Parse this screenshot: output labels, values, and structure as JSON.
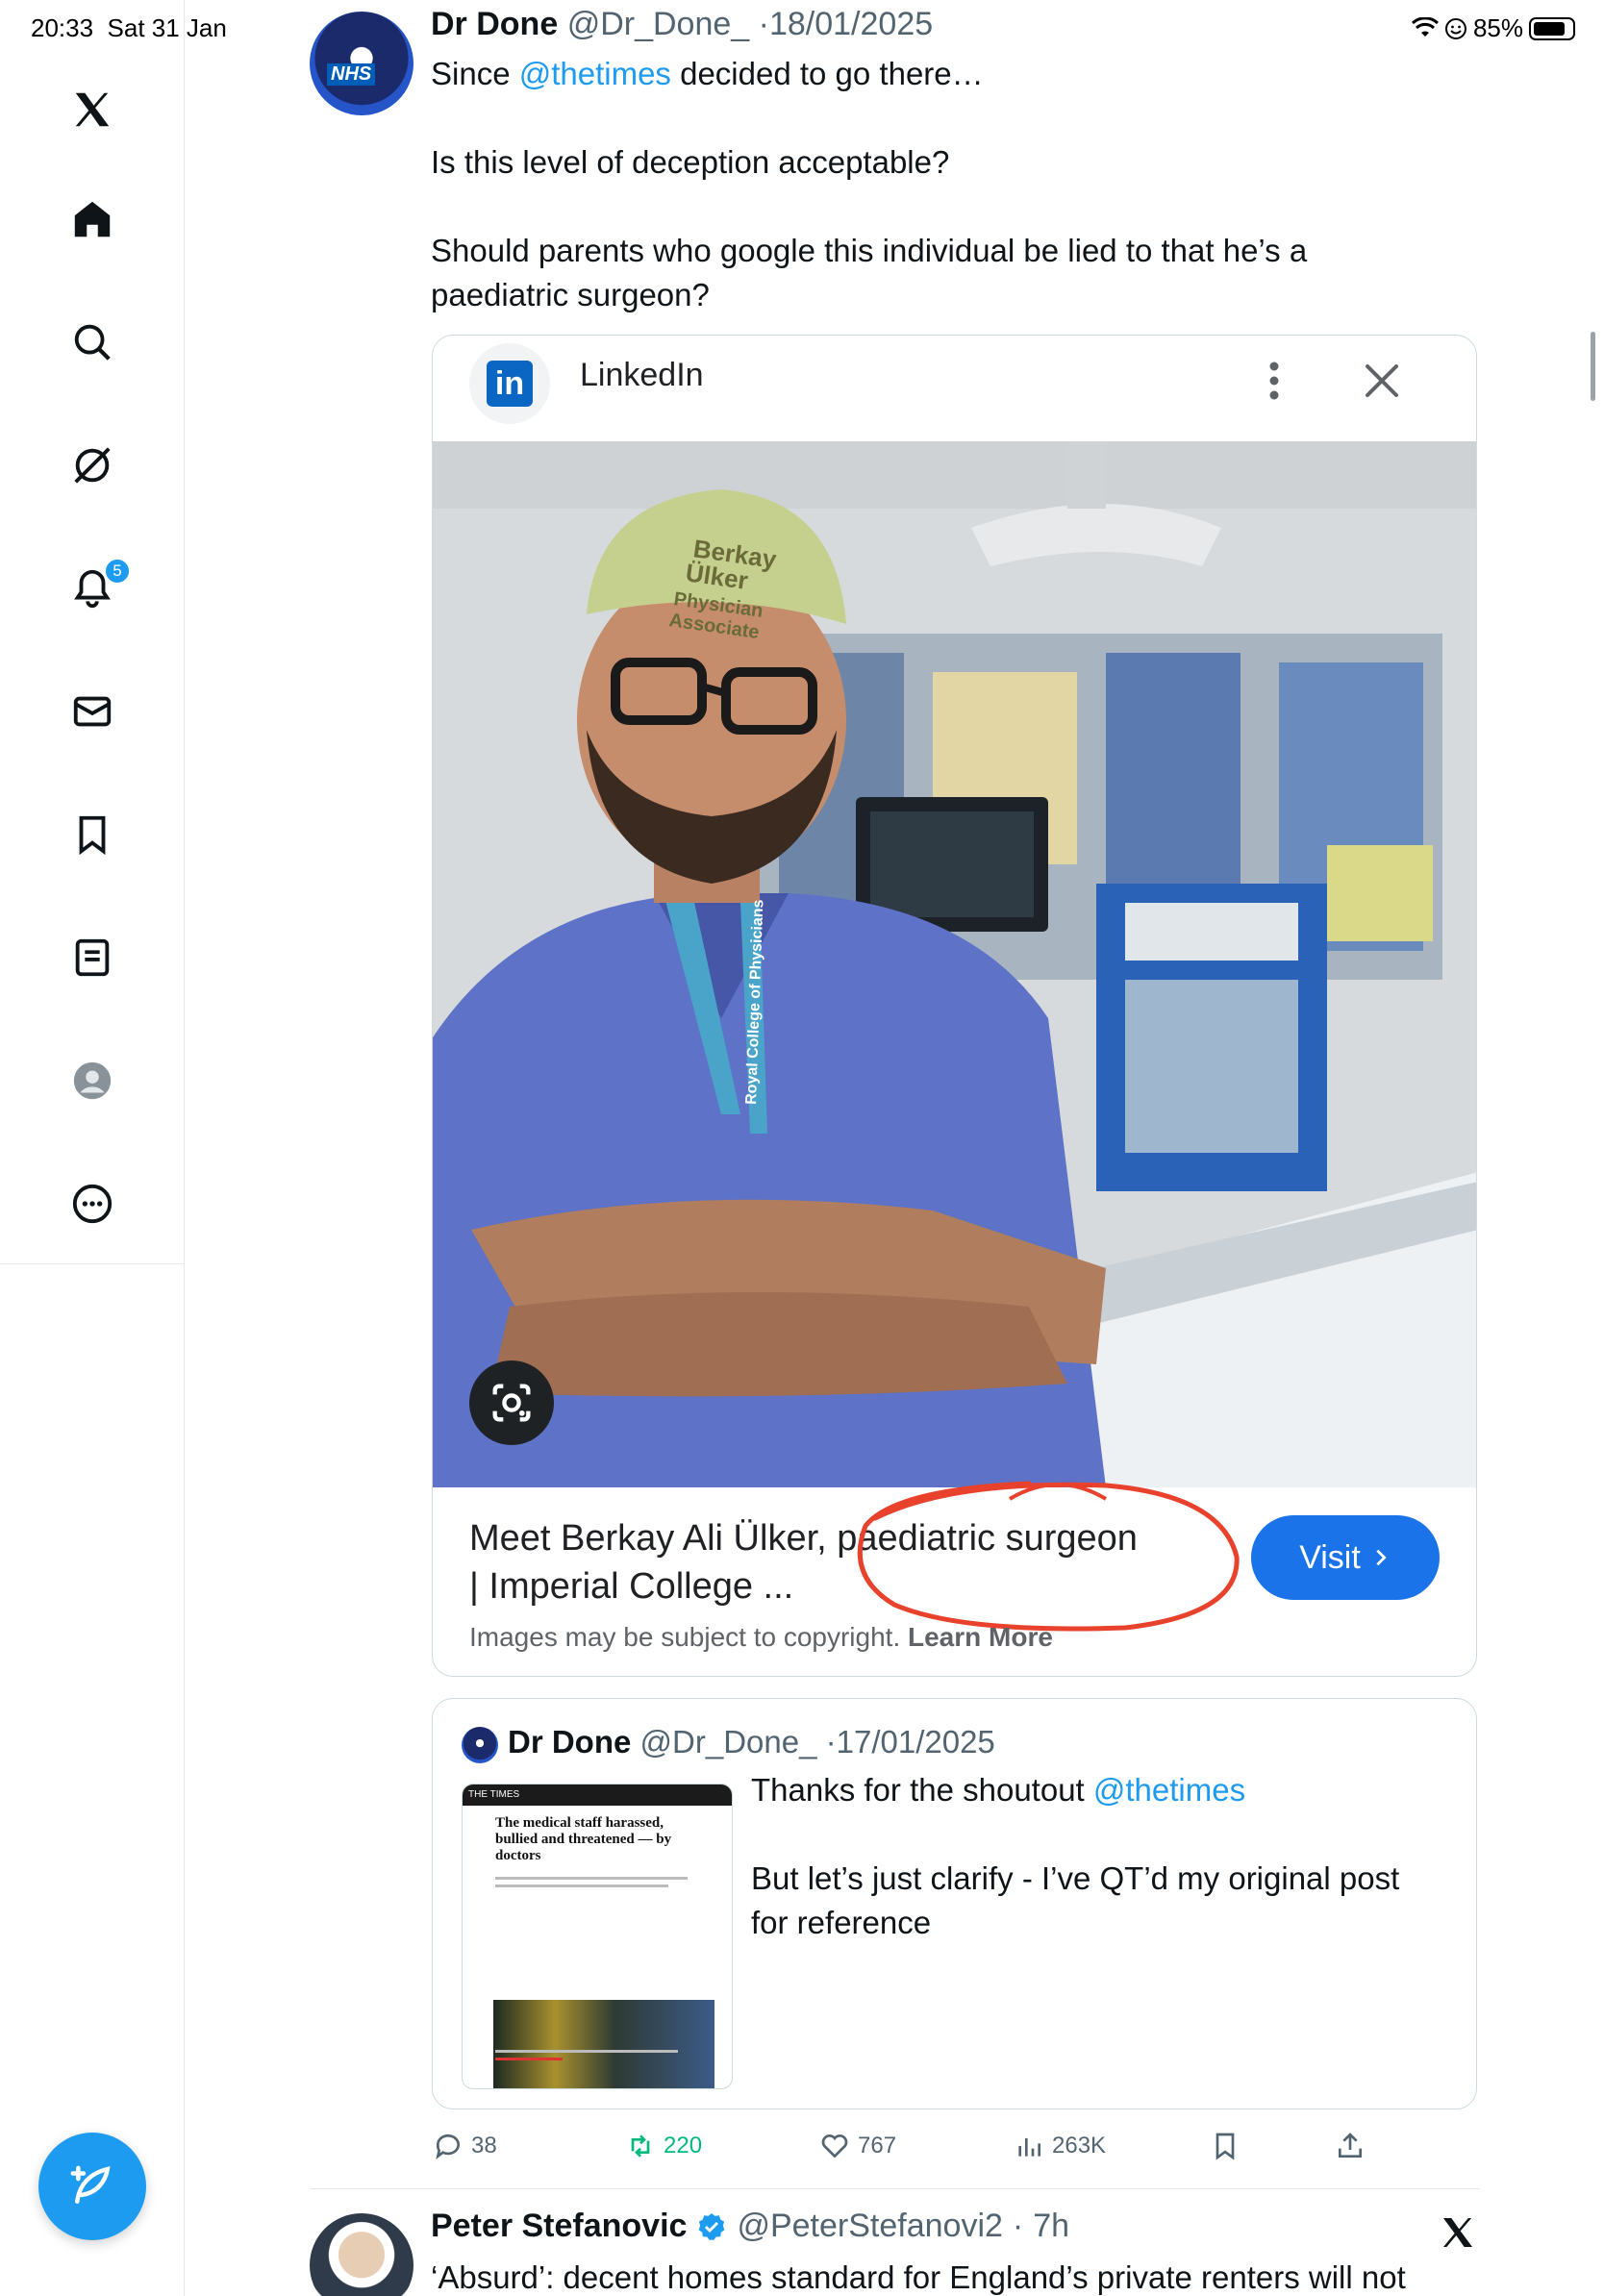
{
  "status_bar": {
    "time": "20:33",
    "date": "Sat 31 Jan",
    "battery": "85%",
    "battery_level": 0.85
  },
  "sidebar": {
    "items": [
      {
        "icon": "x-logo-icon"
      },
      {
        "icon": "home-icon"
      },
      {
        "icon": "search-icon"
      },
      {
        "icon": "grok-icon"
      },
      {
        "icon": "notifications-icon",
        "badge": "5"
      },
      {
        "icon": "messages-icon"
      },
      {
        "icon": "bookmarks-icon"
      },
      {
        "icon": "lists-icon"
      },
      {
        "icon": "profile-icon"
      },
      {
        "icon": "more-icon"
      }
    ],
    "compose_icon": "compose-icon"
  },
  "tweet": {
    "name": "Dr Done",
    "handle": "@Dr_Done_",
    "date": "18/01/2025",
    "avatar_label": "NHS",
    "text_line1_pre": "Since ",
    "text_line1_mention": "@thetimes",
    "text_line1_post": " decided to go there…",
    "text_line2": "Is this level of deception acceptable?",
    "text_line3": "Should parents who google this individual be lied to that he’s a",
    "text_line4": "paediatric surgeon?"
  },
  "lens_card": {
    "source": "LinkedIn",
    "logo_text": "in",
    "cap_text_1": "Berkay",
    "cap_text_2": "Ülker",
    "cap_text_3": "Physician",
    "cap_text_4": "Associate",
    "lanyard_text": "Royal College of Physicians",
    "result_title_1": "Meet Berkay Ali Ülker, paediatric surgeon",
    "result_title_2": "| Imperial College ...",
    "visit_label": "Visit",
    "copyright_text": "Images may be subject to copyright.",
    "learn_more": "Learn More"
  },
  "quote": {
    "name": "Dr Done",
    "handle": "@Dr_Done_",
    "date": "17/01/2025",
    "thumb_masthead": "THE TIMES",
    "thumb_headline": "The medical staff harassed, bullied and threatened — by doctors",
    "text_line1_pre": "Thanks for the shoutout ",
    "text_line1_mention": "@thetimes",
    "text_line2": "But let’s just clarify - I’ve QT’d my original post",
    "text_line3": "for reference"
  },
  "actions": {
    "replies": "38",
    "reposts": "220",
    "likes": "767",
    "views": "263K"
  },
  "next_tweet": {
    "name": "Peter Stefanovic",
    "handle": "@PeterStefanovi2",
    "time": "7h",
    "text": "‘Absurd’: decent homes standard for England’s private renters will not"
  },
  "colors": {
    "accent": "#1d9bf0",
    "repost_green": "#00ba7c",
    "visit_blue": "#1a73e8",
    "annotation_red": "#e8412c"
  }
}
